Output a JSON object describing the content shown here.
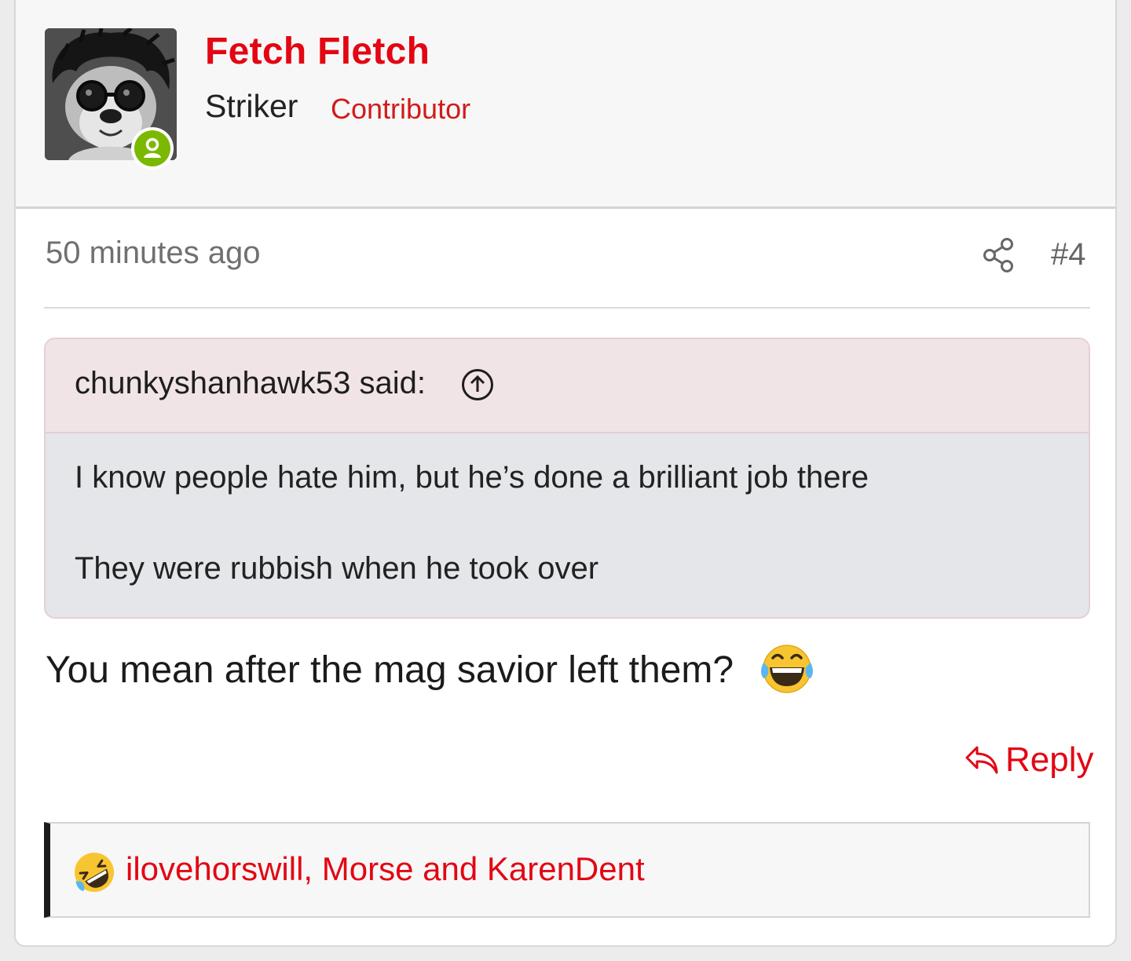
{
  "user": {
    "name": "Fetch Fletch",
    "title": "Striker",
    "role": "Contributor"
  },
  "post": {
    "time": "50 minutes ago",
    "number": "#4",
    "body": "You mean after the mag savior left them?"
  },
  "quote": {
    "author": "chunkyshanhawk53 said:",
    "lines": [
      "I know people hate him, but he’s done a brilliant job there",
      "They were rubbish when he took over"
    ]
  },
  "actions": {
    "reply_label": "Reply"
  },
  "reactions": {
    "names": "ilovehorswill, Morse and KarenDent"
  },
  "icons": {
    "avatar": "dog-with-wig-avatar",
    "online": "online-person-icon",
    "share": "share-icon",
    "quote_up": "arrow-up-circle-icon",
    "body_emoji": "tears-of-joy-emoji",
    "reply": "reply-arrow-icon",
    "reaction": "rolling-on-floor-laughing-emoji"
  },
  "colors": {
    "accent": "#e30613",
    "online": "#7bb800",
    "quote_header_bg": "#f1e4e7",
    "quote_body_bg": "#e4e6e9"
  }
}
